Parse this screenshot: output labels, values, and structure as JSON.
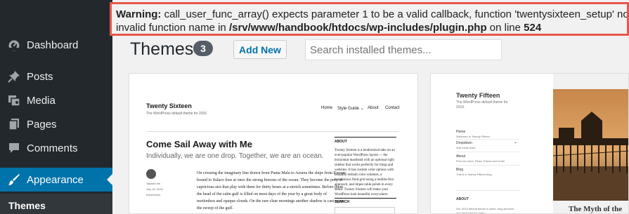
{
  "warning": {
    "label": "Warning:",
    "message_part1": " call_user_func_array() expects parameter 1 to be a valid callback, function 'twentysixteen_setup' not found or",
    "message_part2": "invalid function name in ",
    "file": "/srv/www/handbook/htdocs/wp-includes/plugin.php",
    "on_line": " on line ",
    "line": "524",
    "border_color": "#e8574a"
  },
  "sidebar": {
    "items": [
      {
        "label": "Dashboard",
        "icon": "dashboard-icon"
      },
      {
        "label": "Posts",
        "icon": "pushpin-icon"
      },
      {
        "label": "Media",
        "icon": "media-icon"
      },
      {
        "label": "Pages",
        "icon": "pages-icon"
      },
      {
        "label": "Comments",
        "icon": "comment-icon"
      },
      {
        "label": "Appearance",
        "icon": "paintbrush-icon",
        "active": true
      }
    ],
    "submenu": {
      "label": "Themes"
    },
    "active_color": "#0073aa"
  },
  "header": {
    "title": "Themes",
    "count": "3",
    "add_new_label": "Add New",
    "search_placeholder": "Search installed themes..."
  },
  "theme1": {
    "site_title": "Twenty Sixteen",
    "tagline": "The WordPress default theme for 2016",
    "nav": [
      "Home",
      "Style Guide ⌄",
      "About",
      "Contact"
    ],
    "post_title": "Come Sail Away with Me",
    "post_subtitle": "Individually, we are one drop. Together, we are an ocean.",
    "meta": [
      "Takashi Irie",
      "July 18, 2016",
      "Adventures"
    ],
    "body": "On crossing the imaginary line drawn from Punta Mala to Azuera the ships from Europe bound to Sulaco lose at once the strong breezes of the ocean. They become the prey of capricious airs that play with them for thirty hours at a stretch sometimes. Before them the head of the calm gulf is filled on most days of the year by a great body of motionless and opaque clouds. On the rare clear mornings another shadow is cast upon the sweep of the gulf.",
    "sidebar_heading": "ABOUT",
    "sidebar_text": "Twenty Sixteen is a modernized take on an ever-popular WordPress layout — the horizontal masthead with an optional right sidebar that works perfectly for blogs and websites. It has custom color options with beautiful default color schemes, a harmonious fluid grid using a mobile-first approach, and impeccable polish in every detail. Twenty Sixteen will make your WordPress look beautiful everywhere.",
    "sidebar_heading2": "SEARCH"
  },
  "theme2": {
    "site_title": "Twenty Fifteen",
    "tagline": "The WordPress default theme for 2015.",
    "nav": [
      {
        "label": "Home",
        "sub": "Welcome to Twenty Fifteen"
      },
      {
        "label": "Dropdown",
        "sub": "Sub menu links"
      },
      {
        "label": "About",
        "sub": "Find out more. Read. Follow and more!"
      },
      {
        "label": "Blog",
        "sub": "This is a Twenty Fifteen blog"
      }
    ],
    "about_heading": "ABOUT",
    "about_text": "Our 2015 default theme is clean, blog-focused, and designed for clarity.",
    "post_title": "The Myth of the"
  }
}
